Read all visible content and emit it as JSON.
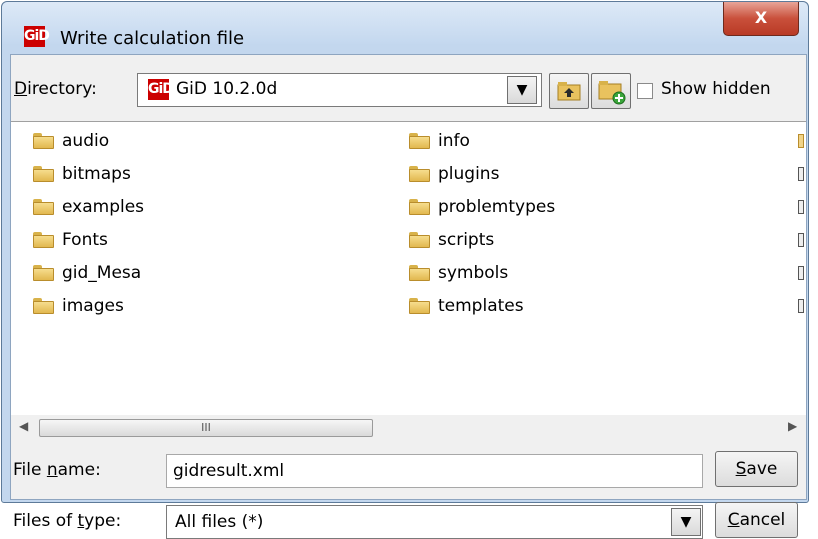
{
  "window": {
    "title": "Write calculation file",
    "app_logo_text": "GiD",
    "close_label": "X"
  },
  "directory": {
    "label_underlined": "D",
    "label_rest": "irectory:",
    "logo_text": "GiD",
    "value": "GiD 10.2.0d",
    "show_hidden_label": "Show hidden"
  },
  "files": {
    "column1": [
      "audio",
      "bitmaps",
      "examples",
      "Fonts",
      "gid_Mesa",
      "images"
    ],
    "column2": [
      "info",
      "plugins",
      "problemtypes",
      "scripts",
      "symbols",
      "templates"
    ]
  },
  "scrollbar": {
    "thumb_grip": "III"
  },
  "filename": {
    "label_pre": "File ",
    "label_underlined": "n",
    "label_post": "ame:",
    "value": "gidresult.xml"
  },
  "filetype": {
    "label_pre": "Files of ",
    "label_underlined": "t",
    "label_post": "ype:",
    "value": "All files (*)"
  },
  "buttons": {
    "save_underlined": "S",
    "save_rest": "ave",
    "cancel_underlined": "C",
    "cancel_rest": "ancel"
  }
}
